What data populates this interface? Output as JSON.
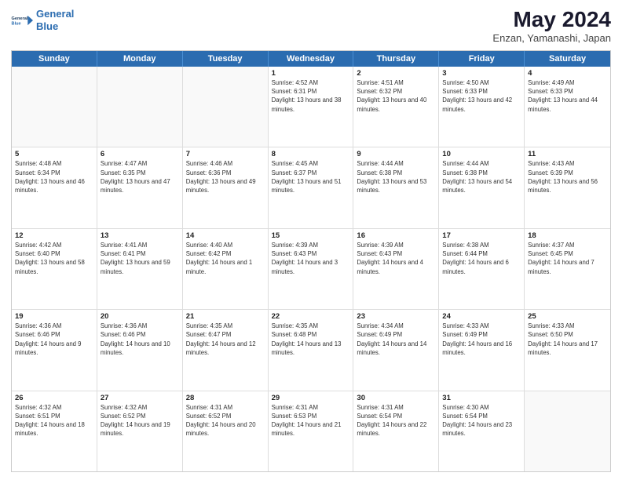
{
  "app": {
    "logo_line1": "General",
    "logo_line2": "Blue"
  },
  "header": {
    "title": "May 2024",
    "subtitle": "Enzan, Yamanashi, Japan"
  },
  "weekdays": [
    "Sunday",
    "Monday",
    "Tuesday",
    "Wednesday",
    "Thursday",
    "Friday",
    "Saturday"
  ],
  "rows": [
    [
      {
        "day": "",
        "sunrise": "",
        "sunset": "",
        "daylight": "",
        "empty": true
      },
      {
        "day": "",
        "sunrise": "",
        "sunset": "",
        "daylight": "",
        "empty": true
      },
      {
        "day": "",
        "sunrise": "",
        "sunset": "",
        "daylight": "",
        "empty": true
      },
      {
        "day": "1",
        "sunrise": "Sunrise: 4:52 AM",
        "sunset": "Sunset: 6:31 PM",
        "daylight": "Daylight: 13 hours and 38 minutes."
      },
      {
        "day": "2",
        "sunrise": "Sunrise: 4:51 AM",
        "sunset": "Sunset: 6:32 PM",
        "daylight": "Daylight: 13 hours and 40 minutes."
      },
      {
        "day": "3",
        "sunrise": "Sunrise: 4:50 AM",
        "sunset": "Sunset: 6:33 PM",
        "daylight": "Daylight: 13 hours and 42 minutes."
      },
      {
        "day": "4",
        "sunrise": "Sunrise: 4:49 AM",
        "sunset": "Sunset: 6:33 PM",
        "daylight": "Daylight: 13 hours and 44 minutes."
      }
    ],
    [
      {
        "day": "5",
        "sunrise": "Sunrise: 4:48 AM",
        "sunset": "Sunset: 6:34 PM",
        "daylight": "Daylight: 13 hours and 46 minutes."
      },
      {
        "day": "6",
        "sunrise": "Sunrise: 4:47 AM",
        "sunset": "Sunset: 6:35 PM",
        "daylight": "Daylight: 13 hours and 47 minutes."
      },
      {
        "day": "7",
        "sunrise": "Sunrise: 4:46 AM",
        "sunset": "Sunset: 6:36 PM",
        "daylight": "Daylight: 13 hours and 49 minutes."
      },
      {
        "day": "8",
        "sunrise": "Sunrise: 4:45 AM",
        "sunset": "Sunset: 6:37 PM",
        "daylight": "Daylight: 13 hours and 51 minutes."
      },
      {
        "day": "9",
        "sunrise": "Sunrise: 4:44 AM",
        "sunset": "Sunset: 6:38 PM",
        "daylight": "Daylight: 13 hours and 53 minutes."
      },
      {
        "day": "10",
        "sunrise": "Sunrise: 4:44 AM",
        "sunset": "Sunset: 6:38 PM",
        "daylight": "Daylight: 13 hours and 54 minutes."
      },
      {
        "day": "11",
        "sunrise": "Sunrise: 4:43 AM",
        "sunset": "Sunset: 6:39 PM",
        "daylight": "Daylight: 13 hours and 56 minutes."
      }
    ],
    [
      {
        "day": "12",
        "sunrise": "Sunrise: 4:42 AM",
        "sunset": "Sunset: 6:40 PM",
        "daylight": "Daylight: 13 hours and 58 minutes."
      },
      {
        "day": "13",
        "sunrise": "Sunrise: 4:41 AM",
        "sunset": "Sunset: 6:41 PM",
        "daylight": "Daylight: 13 hours and 59 minutes."
      },
      {
        "day": "14",
        "sunrise": "Sunrise: 4:40 AM",
        "sunset": "Sunset: 6:42 PM",
        "daylight": "Daylight: 14 hours and 1 minute."
      },
      {
        "day": "15",
        "sunrise": "Sunrise: 4:39 AM",
        "sunset": "Sunset: 6:43 PM",
        "daylight": "Daylight: 14 hours and 3 minutes."
      },
      {
        "day": "16",
        "sunrise": "Sunrise: 4:39 AM",
        "sunset": "Sunset: 6:43 PM",
        "daylight": "Daylight: 14 hours and 4 minutes."
      },
      {
        "day": "17",
        "sunrise": "Sunrise: 4:38 AM",
        "sunset": "Sunset: 6:44 PM",
        "daylight": "Daylight: 14 hours and 6 minutes."
      },
      {
        "day": "18",
        "sunrise": "Sunrise: 4:37 AM",
        "sunset": "Sunset: 6:45 PM",
        "daylight": "Daylight: 14 hours and 7 minutes."
      }
    ],
    [
      {
        "day": "19",
        "sunrise": "Sunrise: 4:36 AM",
        "sunset": "Sunset: 6:46 PM",
        "daylight": "Daylight: 14 hours and 9 minutes."
      },
      {
        "day": "20",
        "sunrise": "Sunrise: 4:36 AM",
        "sunset": "Sunset: 6:46 PM",
        "daylight": "Daylight: 14 hours and 10 minutes."
      },
      {
        "day": "21",
        "sunrise": "Sunrise: 4:35 AM",
        "sunset": "Sunset: 6:47 PM",
        "daylight": "Daylight: 14 hours and 12 minutes."
      },
      {
        "day": "22",
        "sunrise": "Sunrise: 4:35 AM",
        "sunset": "Sunset: 6:48 PM",
        "daylight": "Daylight: 14 hours and 13 minutes."
      },
      {
        "day": "23",
        "sunrise": "Sunrise: 4:34 AM",
        "sunset": "Sunset: 6:49 PM",
        "daylight": "Daylight: 14 hours and 14 minutes."
      },
      {
        "day": "24",
        "sunrise": "Sunrise: 4:33 AM",
        "sunset": "Sunset: 6:49 PM",
        "daylight": "Daylight: 14 hours and 16 minutes."
      },
      {
        "day": "25",
        "sunrise": "Sunrise: 4:33 AM",
        "sunset": "Sunset: 6:50 PM",
        "daylight": "Daylight: 14 hours and 17 minutes."
      }
    ],
    [
      {
        "day": "26",
        "sunrise": "Sunrise: 4:32 AM",
        "sunset": "Sunset: 6:51 PM",
        "daylight": "Daylight: 14 hours and 18 minutes."
      },
      {
        "day": "27",
        "sunrise": "Sunrise: 4:32 AM",
        "sunset": "Sunset: 6:52 PM",
        "daylight": "Daylight: 14 hours and 19 minutes."
      },
      {
        "day": "28",
        "sunrise": "Sunrise: 4:31 AM",
        "sunset": "Sunset: 6:52 PM",
        "daylight": "Daylight: 14 hours and 20 minutes."
      },
      {
        "day": "29",
        "sunrise": "Sunrise: 4:31 AM",
        "sunset": "Sunset: 6:53 PM",
        "daylight": "Daylight: 14 hours and 21 minutes."
      },
      {
        "day": "30",
        "sunrise": "Sunrise: 4:31 AM",
        "sunset": "Sunset: 6:54 PM",
        "daylight": "Daylight: 14 hours and 22 minutes."
      },
      {
        "day": "31",
        "sunrise": "Sunrise: 4:30 AM",
        "sunset": "Sunset: 6:54 PM",
        "daylight": "Daylight: 14 hours and 23 minutes."
      },
      {
        "day": "",
        "sunrise": "",
        "sunset": "",
        "daylight": "",
        "empty": true
      }
    ]
  ]
}
